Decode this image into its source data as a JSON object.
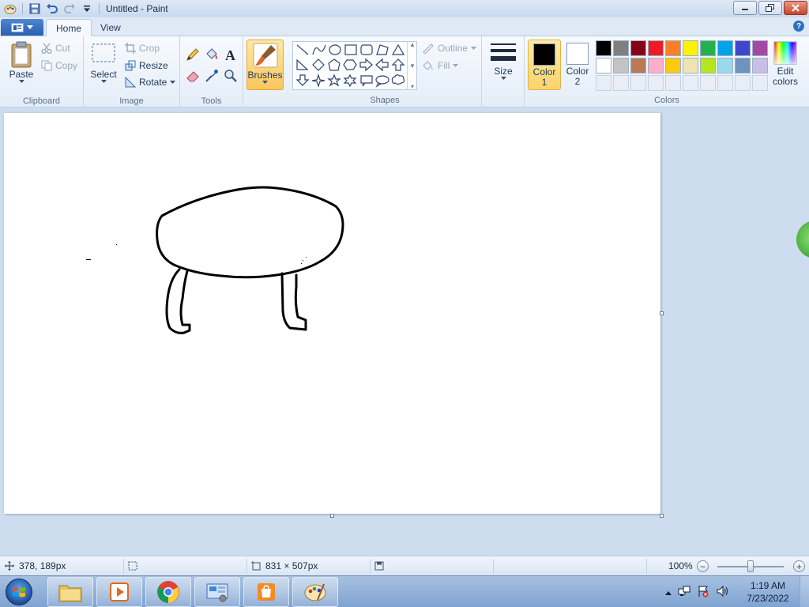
{
  "window": {
    "title": "Untitled - Paint"
  },
  "tabs": [
    {
      "label": "Home"
    },
    {
      "label": "View"
    }
  ],
  "ribbon": {
    "clipboard": {
      "group_label": "Clipboard",
      "paste": "Paste",
      "cut": "Cut",
      "copy": "Copy"
    },
    "image": {
      "group_label": "Image",
      "select": "Select",
      "crop": "Crop",
      "resize": "Resize",
      "rotate": "Rotate"
    },
    "tools": {
      "group_label": "Tools",
      "items": [
        "pencil-icon",
        "fill-icon",
        "text-icon",
        "eraser-icon",
        "color-picker-icon",
        "magnifier-icon"
      ]
    },
    "brushes": {
      "label": "Brushes"
    },
    "shapes": {
      "group_label": "Shapes",
      "outline": "Outline",
      "fill": "Fill"
    },
    "size": {
      "label": "Size"
    },
    "colors": {
      "group_label": "Colors",
      "color1_label": "Color",
      "color1_num": "1",
      "color1_value": "#000000",
      "color2_label": "Color",
      "color2_num": "2",
      "color2_value": "#ffffff",
      "edit_label": "Edit",
      "edit_label2": "colors",
      "palette": [
        "#000000",
        "#7f7f7f",
        "#880015",
        "#ed1c24",
        "#ff7f27",
        "#fff200",
        "#22b14c",
        "#00a2e8",
        "#3f48cc",
        "#a349a4",
        "#ffffff",
        "#c3c3c3",
        "#b97a57",
        "#ffaec9",
        "#ffc90e",
        "#efe4b0",
        "#b5e61d",
        "#99d9ea",
        "#7092be",
        "#c8bfe7",
        "",
        "",
        "",
        "",
        "",
        "",
        "",
        "",
        "",
        ""
      ]
    }
  },
  "status": {
    "cursor_pos": "378, 189px",
    "canvas_size": "831 × 507px",
    "zoom": "100%"
  },
  "taskbar": {
    "apps": [
      "file-explorer-icon",
      "media-player-icon",
      "chrome-icon",
      "control-panel-icon",
      "store-icon",
      "paint-icon"
    ],
    "time": "1:19 AM",
    "date": "7/23/2022"
  }
}
